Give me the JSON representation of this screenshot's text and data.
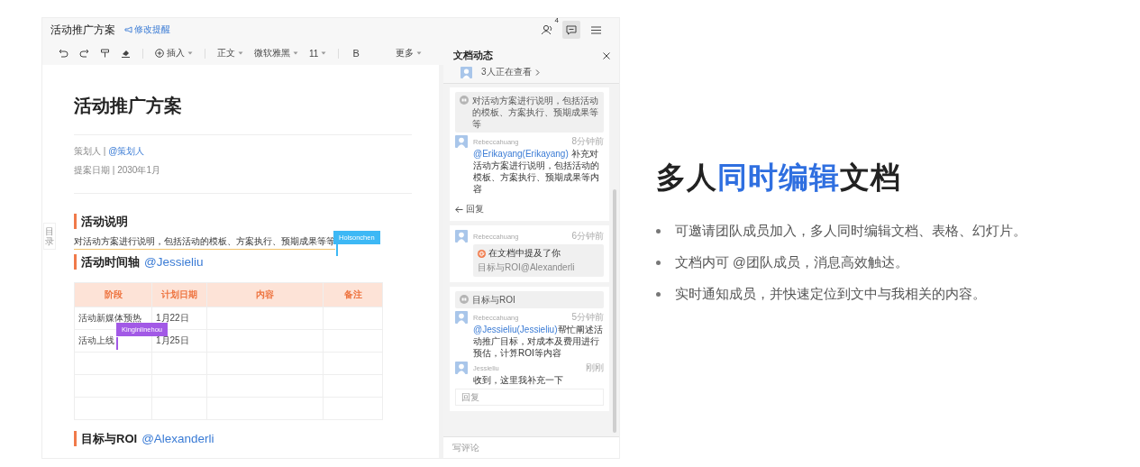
{
  "header": {
    "title": "活动推广方案",
    "reminder": "修改提醒",
    "notification_count": "4",
    "activity_open": true
  },
  "toolbar": {
    "insert": "插入",
    "style": "正文",
    "font": "微软雅黑",
    "size": "11",
    "bold": "B",
    "more": "更多"
  },
  "document": {
    "title": "活动推广方案",
    "outline_tab": "目录",
    "meta": [
      {
        "kind": "mention",
        "text": "策划人 |",
        "mention": "@策划人"
      },
      {
        "kind": "plain",
        "text": "提案日期 | 2030年1月"
      }
    ],
    "blocks": [
      {
        "kind": "heading",
        "text": "活动说明"
      },
      {
        "kind": "paragraph",
        "text": "对活动方案进行说明，包括活动的模板、方案执行、预期成果等等",
        "cursor": {
          "name": "Holsonchen",
          "color": "#3db8f5"
        }
      },
      {
        "kind": "heading",
        "text": "活动时间轴",
        "mention": "@Jessieliu"
      },
      {
        "kind": "table",
        "columns": [
          "阶段",
          "计划日期",
          "内容",
          "备注"
        ],
        "rows": [
          {
            "cells": [
              "活动新媒体预热",
              "1月22日"
            ]
          },
          {
            "cells": [
              "活动上线",
              "1月25日"
            ],
            "cursor": {
              "name": "Kinginlinehou",
              "color": "#a259e6"
            }
          }
        ]
      },
      {
        "kind": "heading",
        "text": "目标与ROI",
        "mention": "@Alexanderli"
      }
    ]
  },
  "activity_panel": {
    "title": "文档动态",
    "viewers": "3人正在查看",
    "cards": [
      {
        "quote": "对活动方案进行说明，包括活动的模板、方案执行、预期成果等等",
        "comments": [
          {
            "author": "Rebeccahuang",
            "time": "8分钟前",
            "mention": "@Erikayang(Erikayang)",
            "text": " 补充对活动方案进行说明，包括活动的模板、方案执行、预期成果等内容"
          }
        ],
        "reply_action": "回复"
      },
      {
        "comments": [
          {
            "author": "Rebeccahuang",
            "time": "6分钟前",
            "notice": "在文档中提及了你",
            "snippet": "目标与ROI@Alexanderli"
          }
        ]
      },
      {
        "quote": "目标与ROI",
        "comments": [
          {
            "author": "Rebeccahuang",
            "time": "5分钟前",
            "mention": "@Jessieliu(Jessieliu)",
            "text": "帮忙阐述活动推广目标，对成本及费用进行预估，计算ROI等内容"
          },
          {
            "author": "Jessieliu",
            "time": "刚刚",
            "text": "收到，这里我补充一下"
          }
        ],
        "reply_placeholder": "回复"
      }
    ],
    "comment_placeholder": "写评论"
  },
  "promo": {
    "title_parts": [
      {
        "text": "多人",
        "highlight": false
      },
      {
        "text": "同时编辑",
        "highlight": true
      },
      {
        "text": "文档",
        "highlight": false
      }
    ],
    "bullets": [
      "可邀请团队成员加入，多人同时编辑文档、表格、幻灯片。",
      "文档内可 @团队成员，消息高效触达。",
      "实时通知成员，并快速定位到文中与我相关的内容。"
    ]
  }
}
